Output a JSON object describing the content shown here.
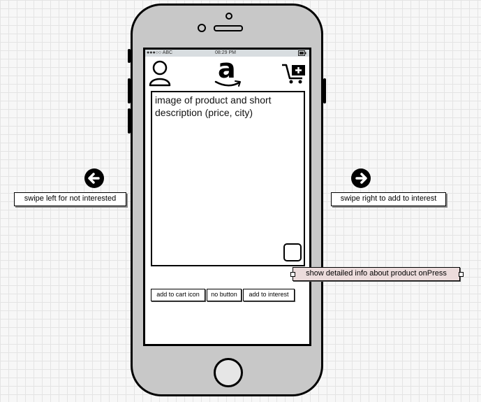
{
  "status_bar": {
    "carrier": "●●●○○ ABC",
    "time": "08:29 PM"
  },
  "header": {
    "profile_icon": "user-icon",
    "logo": "a",
    "cart_icon": "cart-add-icon"
  },
  "product_card": {
    "description": "image of product and short description (price, city)"
  },
  "buttons": {
    "add_to_cart": "add to cart icon",
    "no": "no button",
    "add_to_interest": "add to interest"
  },
  "annotations": {
    "swipe_left": "swipe left for not interested",
    "swipe_right": "swipe right to add to interest",
    "detail_info": "show detailed info about product onPress"
  }
}
